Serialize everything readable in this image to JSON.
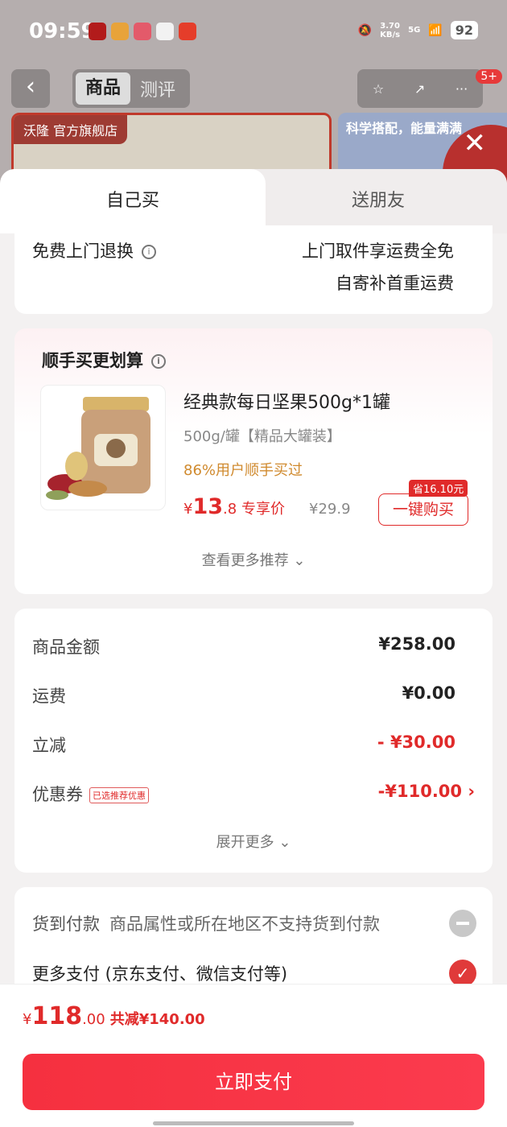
{
  "status_bar": {
    "time": "09:59",
    "battery": "92",
    "net_speed": "3.70\nKB/s",
    "signal": "5G"
  },
  "background_page": {
    "tabs": [
      "商品",
      "测评"
    ],
    "store_tag": "官方旗舰店",
    "brand": "沃隆",
    "promo_text": "科学搭配，能量满满",
    "notification_count": "5+"
  },
  "sheet": {
    "tabs": [
      "自己买",
      "送朋友"
    ],
    "return_label": "免费上门退换",
    "return_line1": "上门取件享运费全免",
    "return_line2": "自寄补首重运费",
    "addon": {
      "title": "顺手买更划算",
      "product_name": "经典款每日坚果500g*1罐",
      "spec": "500g/罐【精品大罐装】",
      "users": "86%用户顺手买过",
      "currency": "¥",
      "price_int": "13",
      "price_dec": ".8",
      "price_tag": "专享价",
      "orig_price": "¥29.9",
      "save_tag": "省16.10元",
      "buy_button": "一键购买",
      "more": "查看更多推荐 ⌄"
    },
    "summary": {
      "rows": [
        {
          "label": "商品金额",
          "value": "¥258.00"
        },
        {
          "label": "运费",
          "value": "¥0.00"
        },
        {
          "label": "立减",
          "value": "- ¥30.00"
        },
        {
          "label": "优惠券",
          "value": "-¥110.00 ›",
          "tag": "已选推荐优惠"
        }
      ],
      "expand": "展开更多 ⌄"
    },
    "payment": {
      "cod_label": "货到付款",
      "cod_desc": "商品属性或所在地区不支持货到付款",
      "more_label": "更多支付 (京东支付、微信支付等)"
    }
  },
  "bottom": {
    "currency": "¥",
    "total_int": "118",
    "total_dec": ".00",
    "saved": "共减¥140.00",
    "pay_button": "立即支付"
  },
  "colors": {
    "accent": "#e02a2a",
    "pay_button": "#f5303f"
  }
}
